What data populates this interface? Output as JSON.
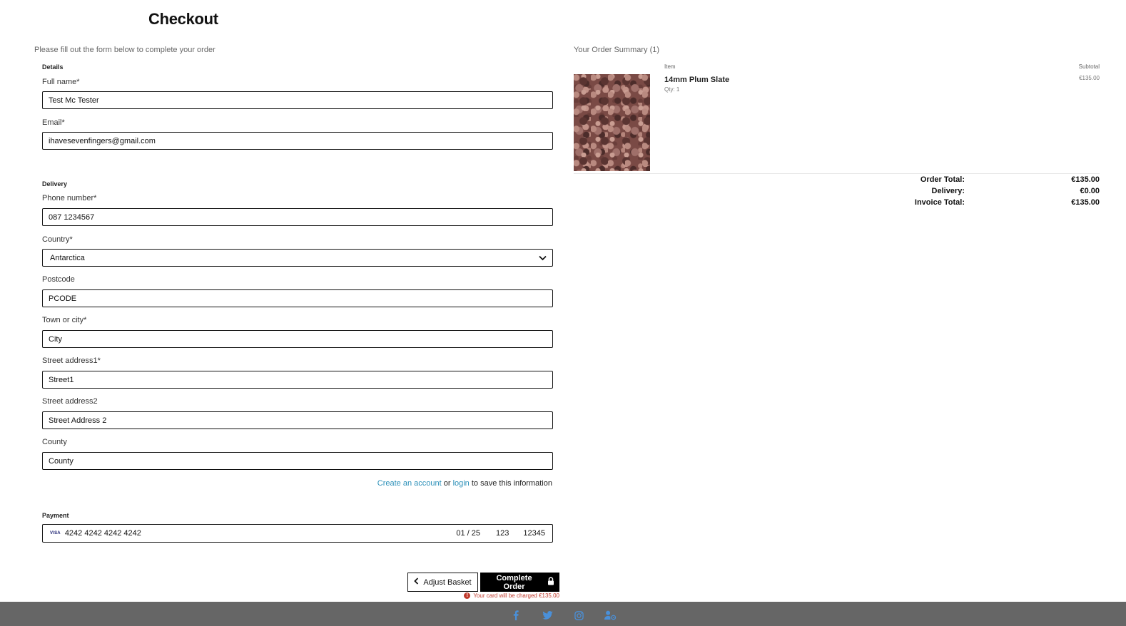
{
  "page": {
    "title": "Checkout",
    "intro": "Please fill out the form below to complete your order"
  },
  "form": {
    "details_label": "Details",
    "delivery_label": "Delivery",
    "payment_label": "Payment",
    "fields": {
      "full_name": {
        "label": "Full name*",
        "value": "Test Mc Tester"
      },
      "email": {
        "label": "Email*",
        "value": "ihavesevenfingers@gmail.com"
      },
      "phone": {
        "label": "Phone number*",
        "value": "087 1234567"
      },
      "country": {
        "label": "Country*",
        "value": "Antarctica"
      },
      "postcode": {
        "label": "Postcode",
        "value": "PCODE"
      },
      "town": {
        "label": "Town or city*",
        "value": "City"
      },
      "street1": {
        "label": "Street address1*",
        "value": "Street1"
      },
      "street2": {
        "label": "Street address2",
        "value": "Street Address 2"
      },
      "county": {
        "label": "County",
        "value": "County"
      }
    },
    "account_note": {
      "create_link": "Create an account",
      "or": "or",
      "login_link": "login",
      "suffix": "to save this information"
    },
    "card": {
      "brand": "VISA",
      "number": "4242 4242 4242 4242",
      "expiry": "01 / 25",
      "cvc": "123",
      "postal": "12345"
    },
    "buttons": {
      "adjust": "Adjust Basket",
      "complete": "Complete Order"
    },
    "charge_note": "Your card will be charged €135.00"
  },
  "summary": {
    "title": "Your Order Summary (1)",
    "col_item": "Item",
    "col_subtotal": "Subtotal",
    "items": [
      {
        "name": "14mm Plum Slate",
        "qty": "Qty: 1",
        "subtotal": "€135.00"
      }
    ],
    "totals": {
      "order_total_label": "Order Total:",
      "order_total": "€135.00",
      "delivery_label": "Delivery:",
      "delivery": "€0.00",
      "invoice_total_label": "Invoice Total:",
      "invoice_total": "€135.00"
    }
  },
  "footer": {
    "icons": [
      "facebook-icon",
      "twitter-icon",
      "instagram-icon",
      "user-cog-icon"
    ],
    "icon_color": "#4a90d9"
  },
  "colors": {
    "link": "#2a8fb8",
    "error": "#c0392b",
    "footer_bg": "#666666",
    "primary_button": "#000000"
  }
}
